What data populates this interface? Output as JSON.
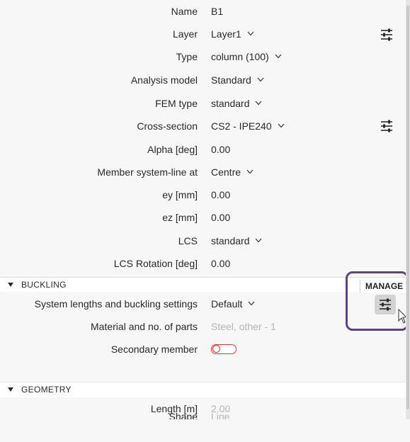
{
  "properties": [
    {
      "label": "Name",
      "value": "B1",
      "dropdown": false
    },
    {
      "label": "Layer",
      "value": "Layer1",
      "dropdown": true
    },
    {
      "label": "Type",
      "value": "column (100)",
      "dropdown": true
    },
    {
      "label": "Analysis model",
      "value": "Standard",
      "dropdown": true
    },
    {
      "label": "FEM type",
      "value": "standard",
      "dropdown": true
    },
    {
      "label": "Cross-section",
      "value": "CS2 - IPE240",
      "dropdown": true
    },
    {
      "label": "Alpha [deg]",
      "value": "0.00",
      "dropdown": false
    },
    {
      "label": "Member system-line at",
      "value": "Centre",
      "dropdown": true
    },
    {
      "label": "ey [mm]",
      "value": "0.00",
      "dropdown": false
    },
    {
      "label": "ez [mm]",
      "value": "0.00",
      "dropdown": false
    },
    {
      "label": "LCS",
      "value": "standard",
      "dropdown": true
    },
    {
      "label": "LCS Rotation [deg]",
      "value": "0.00",
      "dropdown": false
    }
  ],
  "buckling": {
    "title": "BUCKLING",
    "manage_label": "MANAGE",
    "system_lengths_label": "System lengths and buckling settings",
    "system_lengths_value": "Default",
    "material_label": "Material and no. of parts",
    "material_value": "Steel, other - 1",
    "secondary_label": "Secondary member",
    "secondary_on": false
  },
  "geometry": {
    "title": "GEOMETRY",
    "length_label": "Length [m]",
    "length_value": "2.00",
    "shape_label": "Shape",
    "shape_value": "Line"
  },
  "colors": {
    "highlight": "#5a4580",
    "toggle_off": "#dd3333",
    "muted_text": "#b4b4b4"
  }
}
